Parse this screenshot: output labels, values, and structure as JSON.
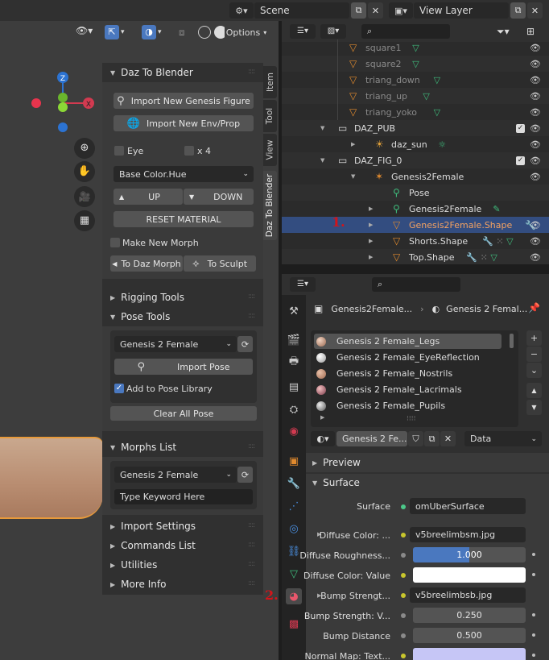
{
  "top_bar": {
    "scene_label": "Scene",
    "view_layer_label": "View Layer"
  },
  "viewport": {
    "options_label": "Options",
    "gizmo_z": "Z",
    "gizmo_x": "X"
  },
  "side_tabs": [
    "Item",
    "Tool",
    "View",
    "Daz To Blender"
  ],
  "daz_panel": {
    "title": "Daz To Blender",
    "import_figure": "Import New Genesis Figure",
    "import_env": "Import New Env/Prop",
    "eye_label": "Eye",
    "x4_label": "x 4",
    "material_select": "Base Color.Hue",
    "up_label": "UP",
    "down_label": "DOWN",
    "reset_material": "RESET MATERIAL",
    "make_morph": "Make New Morph",
    "to_daz_morph": "To Daz Morph",
    "to_sculpt": "To Sculpt"
  },
  "rigging_tools": {
    "title": "Rigging Tools"
  },
  "pose_tools": {
    "title": "Pose Tools",
    "figure_select": "Genesis 2 Female",
    "import_pose": "Import Pose",
    "add_to_library": "Add to Pose Library",
    "add_to_library_checked": true,
    "clear_all_pose": "Clear All Pose"
  },
  "morphs_list": {
    "title": "Morphs List",
    "figure_select": "Genesis 2 Female",
    "keyword_placeholder": "Type Keyword Here"
  },
  "collapsed_panels": [
    "Import Settings",
    "Commands List",
    "Utilities",
    "More Info"
  ],
  "outliner": {
    "rows": [
      {
        "label": "square1",
        "type": "mesh"
      },
      {
        "label": "square2",
        "type": "mesh"
      },
      {
        "label": "triang_down",
        "type": "mesh"
      },
      {
        "label": "triang_up",
        "type": "mesh"
      },
      {
        "label": "triang_yoko",
        "type": "mesh"
      },
      {
        "label": "DAZ_PUB",
        "type": "collection"
      },
      {
        "label": "daz_sun",
        "type": "light"
      },
      {
        "label": "DAZ_FIG_0",
        "type": "collection"
      },
      {
        "label": "Genesis2Female",
        "type": "armature"
      },
      {
        "label": "Pose",
        "type": "pose"
      },
      {
        "label": "Genesis2Female",
        "type": "armature-data"
      },
      {
        "label": "Genesis2Female.Shape",
        "type": "mesh",
        "selected": true
      },
      {
        "label": "Shorts.Shape",
        "type": "mesh"
      },
      {
        "label": "Top.Shape",
        "type": "mesh"
      }
    ]
  },
  "annotations": {
    "marker_1": "1.",
    "marker_2": "2."
  },
  "properties": {
    "breadcrumb_object": "Genesis2Female...",
    "breadcrumb_material": "Genesis 2 Femal...",
    "materials": [
      "Genesis 2 Female_Legs",
      "Genesis 2 Female_EyeReflection",
      "Genesis 2 Female_Nostrils",
      "Genesis 2 Female_Lacrimals",
      "Genesis 2 Female_Pupils"
    ],
    "material_name": "Genesis 2 Fe...",
    "link_select": "Data",
    "preview_label": "Preview",
    "surface_section": "Surface",
    "fields": [
      {
        "label": "Surface",
        "value": "omUberSurface"
      },
      {
        "label": "Diffuse Color: ...",
        "value": "v5breelimbsm.jpg"
      },
      {
        "label": "Diffuse Roughness...",
        "value": "1.000"
      },
      {
        "label": "Diffuse Color: Value",
        "value": ""
      },
      {
        "label": "Bump Strengt...",
        "value": "v5breelimbsb.jpg"
      },
      {
        "label": "Bump Strength: V...",
        "value": "0.250"
      },
      {
        "label": "Bump Distance",
        "value": "0.500"
      },
      {
        "label": "Normal Map: Text...",
        "value": ""
      }
    ],
    "diffuse_roughness_fill": 1.0
  },
  "colors": {
    "accent_blue": "#4a78bf",
    "selected_row": "#334d80",
    "annotation_red": "#d4141a",
    "mesh_orange": "#e08a2e"
  }
}
